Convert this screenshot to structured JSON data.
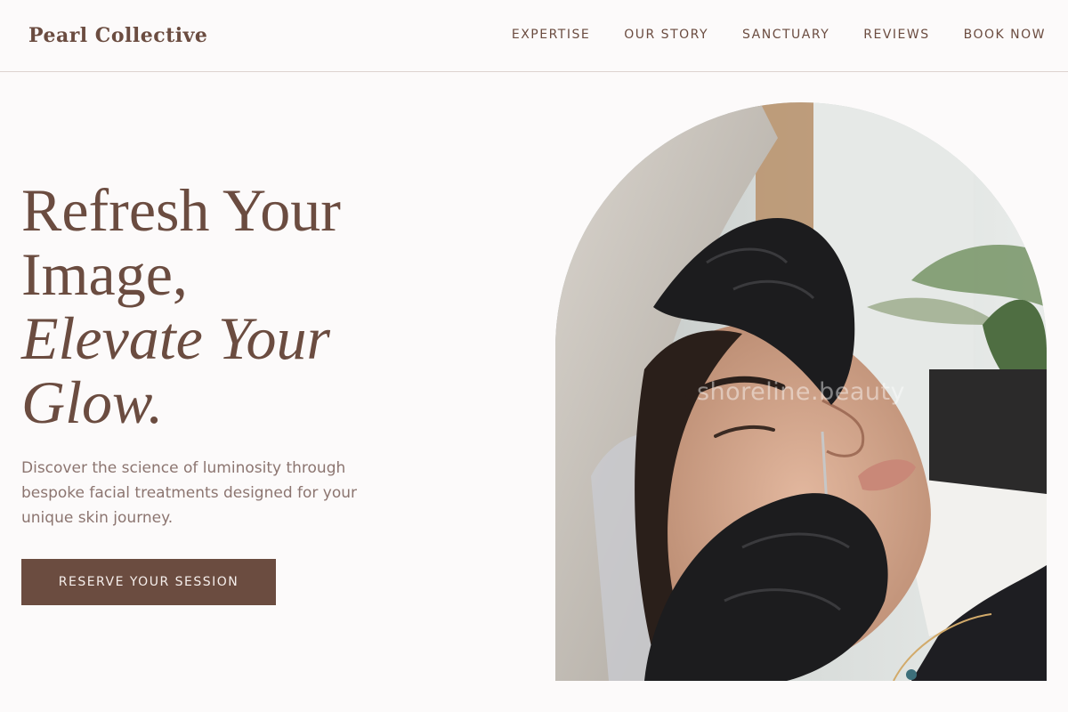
{
  "header": {
    "brand": "Pearl Collective",
    "nav": [
      {
        "label": "EXPERTISE"
      },
      {
        "label": "OUR STORY"
      },
      {
        "label": "SANCTUARY"
      },
      {
        "label": "REVIEWS"
      },
      {
        "label": "BOOK NOW"
      }
    ]
  },
  "hero": {
    "title_line1": "Refresh Your",
    "title_line2": "Image,",
    "title_line3": "Elevate Your",
    "title_line4": "Glow.",
    "description": "Discover the science of luminosity through bespoke facial treatments designed for your unique skin journey.",
    "cta_label": "RESERVE YOUR SESSION"
  },
  "image": {
    "watermark": "shoreline.beauty"
  },
  "colors": {
    "brand_brown": "#6b4c40",
    "page_background": "#fcfafa",
    "body_text": "#8c7570"
  }
}
